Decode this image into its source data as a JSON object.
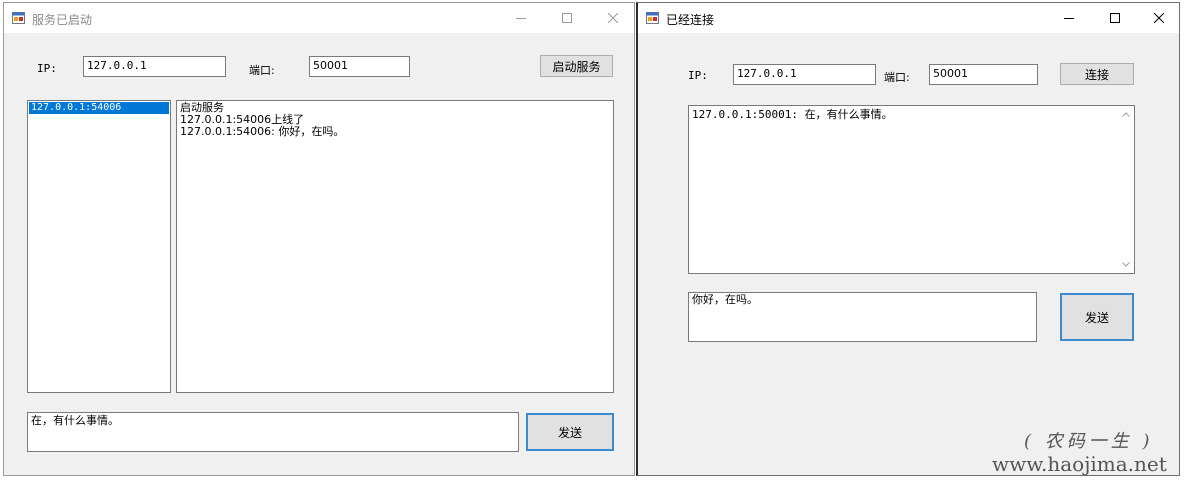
{
  "server": {
    "title": "服务已启动",
    "ip_label": "IP:",
    "ip_value": "127.0.0.1",
    "port_label": "端口:",
    "port_value": "50001",
    "start_button": "启动服务",
    "clients": [
      "127.0.0.1:54006"
    ],
    "log": [
      "启动服务",
      "127.0.0.1:54006上线了",
      "127.0.0.1:54006: 你好，在吗。"
    ],
    "message_value": "在，有什么事情。",
    "send_button": "发送"
  },
  "client": {
    "title": "已经连接",
    "ip_label": "IP:",
    "ip_value": "127.0.0.1",
    "port_label": "端口:",
    "port_value": "50001",
    "connect_button": "连接",
    "log": [
      "127.0.0.1:50001: 在，有什么事情。"
    ],
    "message_value": "你好，在吗。",
    "send_button": "发送"
  },
  "watermark": {
    "line1": "( 农码一生 )",
    "line2": "www.haojima.net"
  },
  "icons": [
    "app-form-icon",
    "minimize-icon",
    "maximize-icon",
    "close-icon",
    "scroll-up-icon",
    "scroll-down-icon"
  ]
}
